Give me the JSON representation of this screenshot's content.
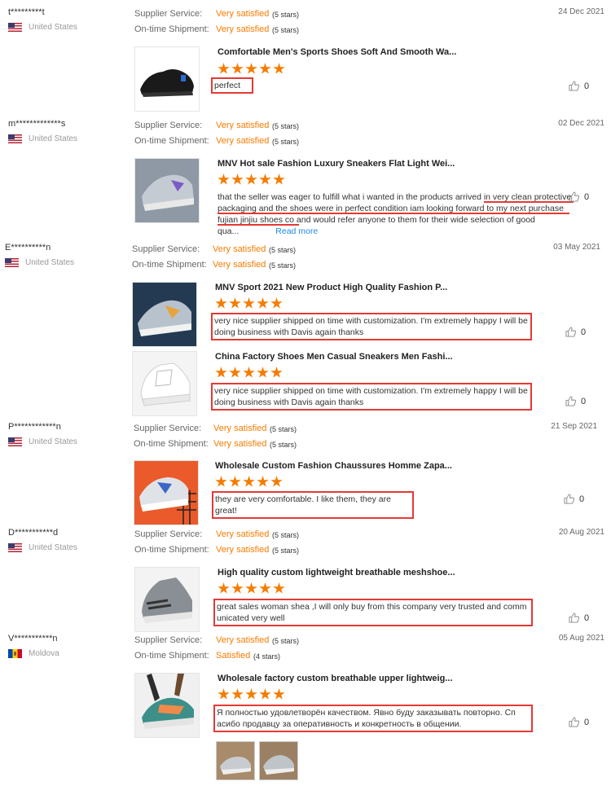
{
  "labels": {
    "supplier_service": "Supplier Service:",
    "on_time": "On-time Shipment:"
  },
  "reviews": [
    {
      "user": "t*********t",
      "country": "United States",
      "date": "24 Dec 2021",
      "supplier": "Very satisfied",
      "supplier_stars": "(5 stars)",
      "shipment": "Very satisfied",
      "shipment_stars": "(5 stars)",
      "products": [
        {
          "title": "Comfortable Men's Sports Shoes Soft And Smooth Wa...",
          "rating": 5,
          "comment": "perfect",
          "likes": "0"
        }
      ]
    },
    {
      "user": "m*************s",
      "country": "United States",
      "date": "02 Dec 2021",
      "supplier": "Very satisfied",
      "supplier_stars": "(5 stars)",
      "shipment": "Very satisfied",
      "shipment_stars": "(5 stars)",
      "products": [
        {
          "title": "MNV Hot sale Fashion Luxury Sneakers Flat Light Wei...",
          "rating": 5,
          "comment_lines": [
            "that the seller was eager to fulfill what i wanted in the products arrived in very clean protective",
            "packaging and the shoes were in perfect condition iam looking forward to my next purchase",
            "fujian jinjiu shoes co and would refer anyone to them for their wide selection of good",
            "qua..."
          ],
          "read_more": "Read more",
          "likes": "0"
        }
      ]
    },
    {
      "user": "E**********n",
      "country": "United States",
      "date": "03 May 2021",
      "supplier": "Very satisfied",
      "supplier_stars": "(5 stars)",
      "shipment": "Very satisfied",
      "shipment_stars": "(5 stars)",
      "products": [
        {
          "title": "MNV Sport 2021 New Product High Quality Fashion P...",
          "rating": 5,
          "comment_lines": [
            "very nice supplier shipped on time with customization. I'm extremely happy I will be",
            "doing business with Davis again thanks"
          ],
          "likes": "0"
        },
        {
          "title": "China Factory Shoes Men Casual Sneakers Men Fashi...",
          "rating": 5,
          "comment_lines": [
            "very nice supplier shipped on time with customization. I'm extremely happy I will be",
            "doing business with Davis again thanks"
          ],
          "likes": "0"
        }
      ]
    },
    {
      "user": "P************n",
      "country": "United States",
      "date": "21 Sep 2021",
      "supplier": "Very satisfied",
      "supplier_stars": "(5 stars)",
      "shipment": "Very satisfied",
      "shipment_stars": "(5 stars)",
      "products": [
        {
          "title": "Wholesale Custom Fashion Chaussures Homme Zapa...",
          "rating": 5,
          "comment": "they are very comfortable. I like them, they are great!",
          "likes": "0"
        }
      ]
    },
    {
      "user": "D***********d",
      "country": "United States",
      "date": "20 Aug 2021",
      "supplier": "Very satisfied",
      "supplier_stars": "(5 stars)",
      "shipment": "Very satisfied",
      "shipment_stars": "(5 stars)",
      "products": [
        {
          "title": "High quality custom lightweight breathable meshshoe...",
          "rating": 5,
          "comment_lines": [
            "great sales woman shea ,I will only buy from this company very trusted and comm",
            "unicated very well"
          ],
          "likes": "0"
        }
      ]
    },
    {
      "user": "V***********n",
      "country": "Moldova",
      "date": "05 Aug 2021",
      "supplier": "Very satisfied",
      "supplier_stars": "(5 stars)",
      "shipment": "Satisfied",
      "shipment_stars": "(4 stars)",
      "products": [
        {
          "title": "Wholesale factory custom breathable upper lightweig...",
          "rating": 5,
          "comment_lines": [
            "Я полностью удовлетворён качеством. Явно буду заказывать повторно. Сп",
            "асибо продавцу за оперативность и конкретность в общении."
          ],
          "likes": "0"
        }
      ]
    }
  ],
  "colors": {
    "accent": "#f57c00",
    "highlight_border": "#e53935",
    "link": "#1e88e5"
  }
}
